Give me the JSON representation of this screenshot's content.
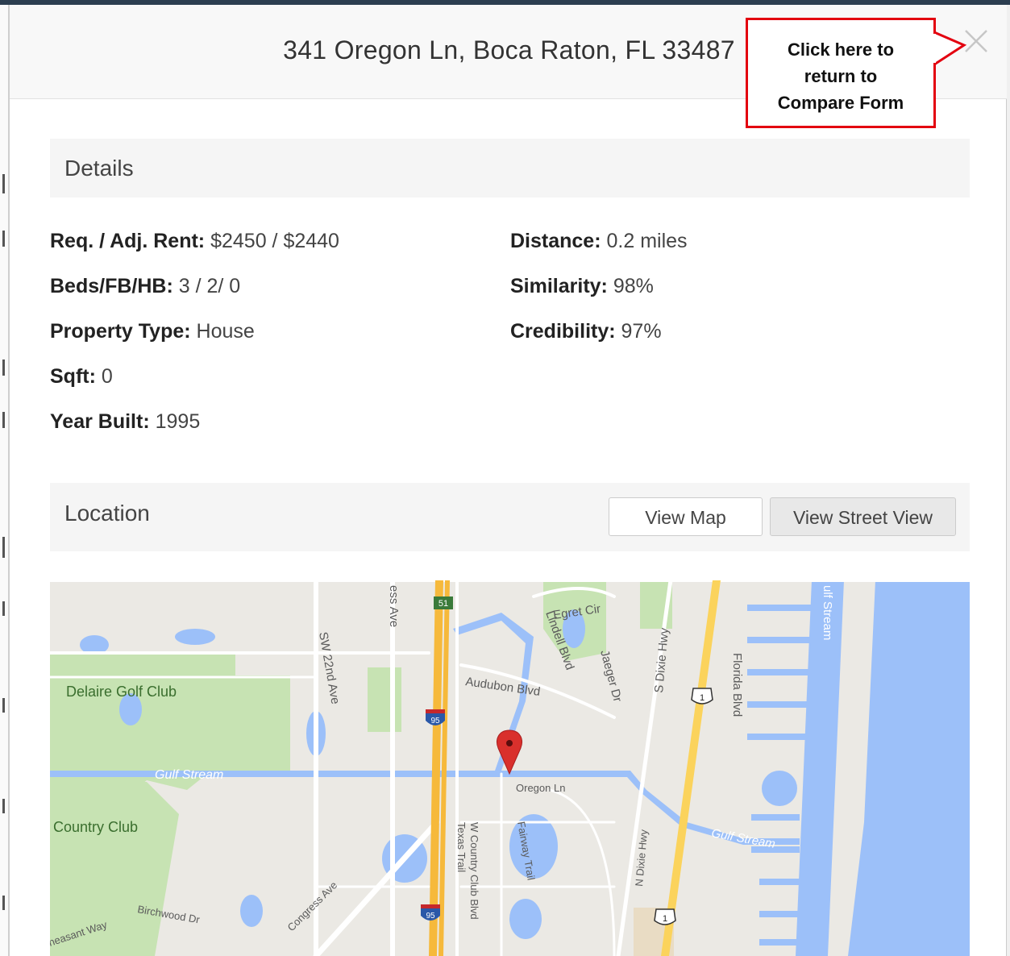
{
  "modal": {
    "title": "341 Oregon Ln, Boca Raton, FL 33487",
    "close_icon": "close-icon"
  },
  "callout": {
    "lines": [
      "Click here to",
      "return to",
      "Compare Form"
    ],
    "border_color": "#e3000f"
  },
  "details": {
    "heading": "Details",
    "left": [
      {
        "label": "Req. / Adj. Rent:",
        "value": " $2450 / $2440"
      },
      {
        "label": "Beds/FB/HB:",
        "value": " 3 / 2/ 0"
      },
      {
        "label": "Property Type:",
        "value": " House"
      },
      {
        "label": "Sqft:",
        "value": " 0"
      },
      {
        "label": "Year Built:",
        "value": " 1995"
      }
    ],
    "right": [
      {
        "label": "Distance:",
        "value": " 0.2 miles"
      },
      {
        "label": "Similarity:",
        "value": " 98%"
      },
      {
        "label": "Credibility:",
        "value": " 97%"
      }
    ]
  },
  "location": {
    "heading": "Location",
    "view_map_label": "View Map",
    "street_view_label": "View Street View"
  },
  "map": {
    "labels": {
      "egret": "Egret Cir",
      "ess_ave": "ess Ave",
      "gulf_stream_top": "ulf Stream",
      "lindell": "Lindell Blvd",
      "jaeger": "Jaeger Dr",
      "s_dixie": "S Dixie Hwy",
      "florida": "Florida Blvd",
      "sw22": "SW 22nd Ave",
      "audubon": "Audubon Blvd",
      "delaire": "Delaire Golf Club",
      "gulf_stream_left": "Gulf Stream",
      "oregon": "Oregon Ln",
      "gulf_stream_right": "Gulf Stream",
      "country_club": "Country Club",
      "w_country": "W Country Club Blvd",
      "texas": "Texas Trail",
      "fairway": "Fairway Trail",
      "n_dixie": "N Dixie Hwy",
      "congress": "Congress Ave",
      "birchwood": "Birchwood Dr",
      "pheasant": "heasant Way"
    },
    "shields": {
      "route51": "51",
      "i95_top": "95",
      "i95_bottom": "95",
      "us1_top": "1",
      "us1_bottom": "1"
    },
    "colors": {
      "land": "#ebe9e4",
      "water": "#9cc0f9",
      "park": "#c7e3b3",
      "highway": "#f6b93b",
      "marker": "#d9302c"
    }
  }
}
